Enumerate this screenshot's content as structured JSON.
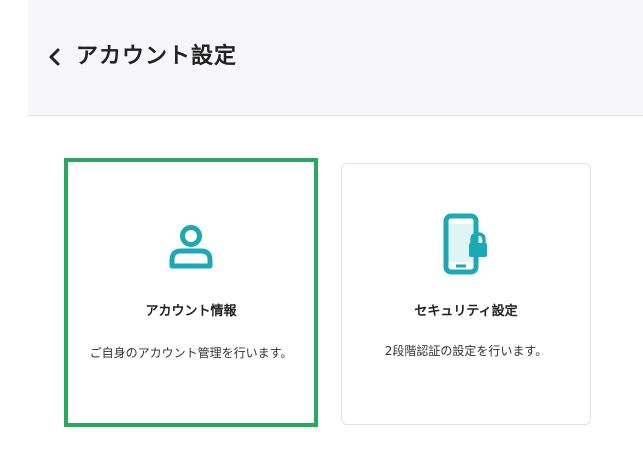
{
  "header": {
    "back_icon": "chevron-left-icon",
    "title": "アカウント設定"
  },
  "cards": [
    {
      "icon": "user-icon",
      "title": "アカウント情報",
      "description": "ご自身のアカウント管理を行います。",
      "selected": true
    },
    {
      "icon": "phone-lock-icon",
      "title": "セキュリティ設定",
      "description": "2段階認証の設定を行います。",
      "selected": false
    }
  ],
  "colors": {
    "accent": "#1ba9b5",
    "selection_border": "#27a85a"
  }
}
